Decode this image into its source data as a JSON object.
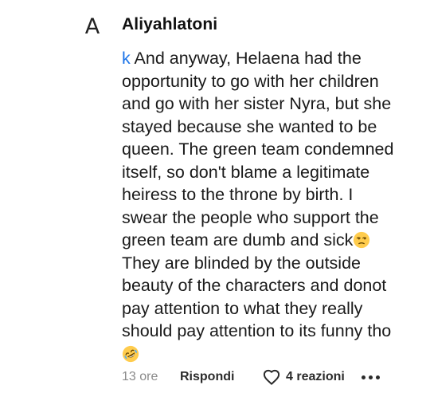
{
  "comment": {
    "avatar_letter": "A",
    "author": "Aliyahlatoni",
    "mention": "k",
    "text_lines": [
      " And anyway, Helaena had the",
      "opportunity to go with her children",
      "and go with her sister Nyra, but she",
      "stayed because she wanted to be",
      "queen. The green team condemned",
      "itself, so don't blame a legitimate",
      "heiress to the throne by birth. I",
      "swear the people who support the",
      "green team are dumb and sick",
      "They are blinded by the outside",
      "beauty of the characters and donot",
      "pay attention to what they really",
      "should pay attention to its funny tho"
    ],
    "emoji_inline": "unamused-face",
    "emoji_end": "rolling-on-floor-laughing",
    "time": "13 ore",
    "reply_label": "Rispondi",
    "reactions_label": "4 reazioni",
    "mention_color": "#1a73e8"
  }
}
